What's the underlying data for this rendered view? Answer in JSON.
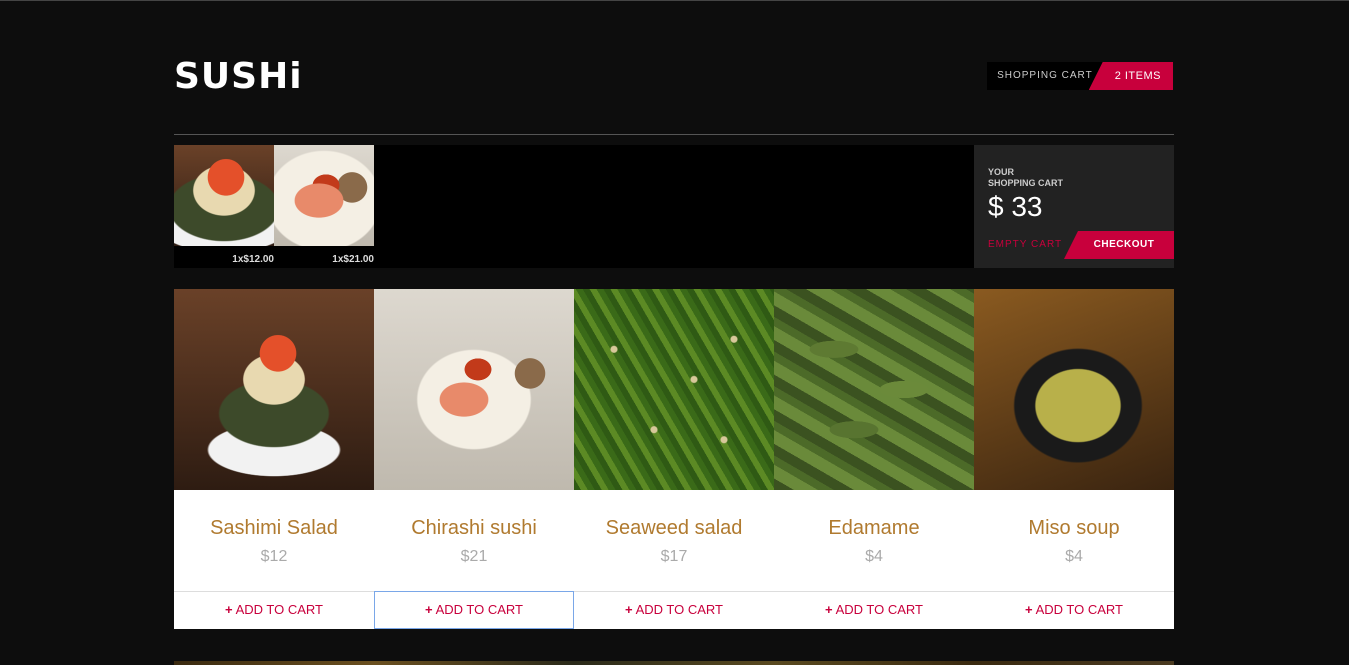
{
  "header": {
    "logo": "SUSHi",
    "cart_label": "SHOPPING CART",
    "cart_count": "2 ITEMS"
  },
  "mini_cart": {
    "items": [
      {
        "price": "1x$12.00"
      },
      {
        "price": "1x$21.00"
      }
    ],
    "title_line1": "YOUR",
    "title_line2": "SHOPPING CART",
    "total": "$ 33",
    "empty_label": "EMPTY CART",
    "checkout_label": "CHECKOUT"
  },
  "products": [
    {
      "name": "Sashimi Salad",
      "price": "$12",
      "add_label": "ADD TO CART"
    },
    {
      "name": "Chirashi sushi",
      "price": "$21",
      "add_label": "ADD TO CART"
    },
    {
      "name": "Seaweed salad",
      "price": "$17",
      "add_label": "ADD TO CART"
    },
    {
      "name": "Edamame",
      "price": "$4",
      "add_label": "ADD TO CART"
    },
    {
      "name": "Miso soup",
      "price": "$4",
      "add_label": "ADD TO CART"
    }
  ],
  "colors": {
    "accent": "#c8003c",
    "product_name": "#b07a2f",
    "background": "#0d0d0d"
  }
}
